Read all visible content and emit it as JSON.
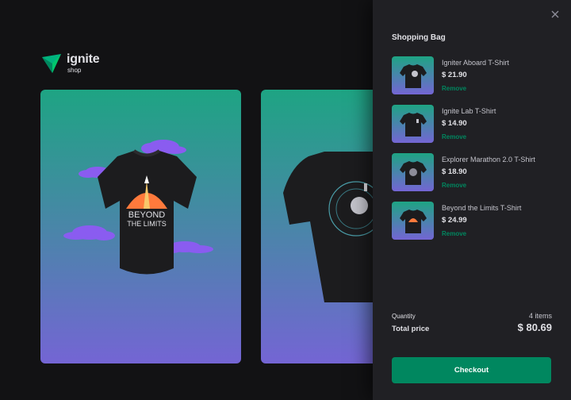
{
  "brand": {
    "name": "ignite",
    "sub": "shop",
    "accent": "#00875f"
  },
  "products": [
    {
      "graphic_text_1": "BEYOND",
      "graphic_text_2": "THE LIMITS"
    },
    {
      "graphic_text_1": ""
    }
  ],
  "cart": {
    "title": "Shopping Bag",
    "close_icon": "close-icon",
    "items": [
      {
        "name": "Igniter Aboard T-Shirt",
        "price": "$ 21.90",
        "remove": "Remove"
      },
      {
        "name": "Ignite Lab T-Shirt",
        "price": "$ 14.90",
        "remove": "Remove"
      },
      {
        "name": "Explorer Marathon 2.0 T-Shirt",
        "price": "$ 18.90",
        "remove": "Remove"
      },
      {
        "name": "Beyond the Limits T-Shirt",
        "price": "$ 24.99",
        "remove": "Remove"
      }
    ],
    "quantity_label": "Quantity",
    "quantity_value": "4 items",
    "total_label": "Total price",
    "total_value": "$ 80.69",
    "checkout_label": "Checkout"
  }
}
